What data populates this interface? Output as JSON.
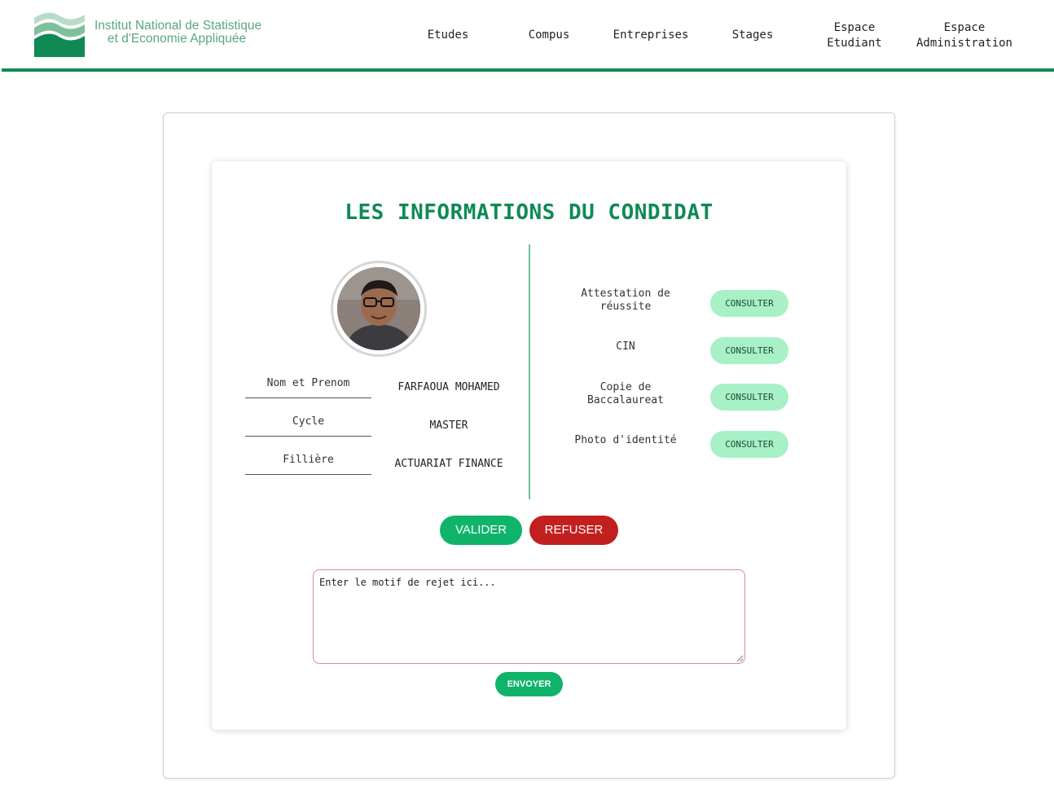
{
  "header": {
    "logo_line1": "Institut National de Statistique",
    "logo_line2": "et d'Economie Appliquée",
    "nav": [
      {
        "label": "Etudes"
      },
      {
        "label": "Compus"
      },
      {
        "label": "Entreprises"
      },
      {
        "label": "Stages"
      },
      {
        "label_line1": "Espace",
        "label_line2": "Etudiant"
      },
      {
        "label_line1": "Espace",
        "label_line2": "Administration"
      }
    ]
  },
  "main": {
    "title": "LES INFORMATIONS DU CONDIDAT",
    "candidate": {
      "fields": [
        {
          "label": "Nom et Prenom",
          "value": "FARFAOUA MOHAMED"
        },
        {
          "label": "Cycle",
          "value": "MASTER"
        },
        {
          "label": "Fillière",
          "value": "ACTUARIAT FINANCE"
        }
      ]
    },
    "documents": [
      {
        "label": "Attestation de réussite",
        "button": "CONSULTER"
      },
      {
        "label": "CIN",
        "button": "CONSULTER"
      },
      {
        "label": "Copie de Baccalaureat",
        "button": "CONSULTER"
      },
      {
        "label": "Photo d'identité",
        "button": "CONSULTER"
      }
    ],
    "actions": {
      "valider": "VALIDER",
      "refuser": "REFUSER"
    },
    "motif": {
      "placeholder": "Enter le motif de rejet ici...",
      "value": ""
    },
    "envoyer": "ENVOYER"
  },
  "colors": {
    "brand_green": "#0f8a55",
    "button_green": "#0fb46a",
    "consult_green": "#a8f0c6",
    "refuse_red": "#c21f1f"
  }
}
